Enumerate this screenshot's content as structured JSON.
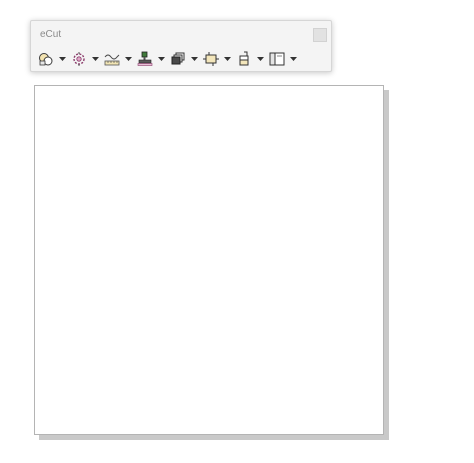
{
  "toolbar": {
    "title": "eCut",
    "tools": [
      {
        "icon": "ecut-logo-icon",
        "has_dropdown": true
      },
      {
        "icon": "gear-target-icon",
        "has_dropdown": true
      },
      {
        "icon": "measure-wave-icon",
        "has_dropdown": true
      },
      {
        "icon": "stamp-icon",
        "has_dropdown": true
      },
      {
        "icon": "stacked-pages-icon",
        "has_dropdown": true
      },
      {
        "icon": "crop-frame-icon",
        "has_dropdown": true
      },
      {
        "icon": "lock-shape-icon",
        "has_dropdown": true
      },
      {
        "icon": "panel-layout-icon",
        "has_dropdown": true
      }
    ]
  },
  "colors": {
    "toolbar_bg": "#f4f4f4",
    "title_text": "#8a8a8a",
    "page_bg": "#ffffff",
    "page_shadow": "#c9c9c9"
  }
}
